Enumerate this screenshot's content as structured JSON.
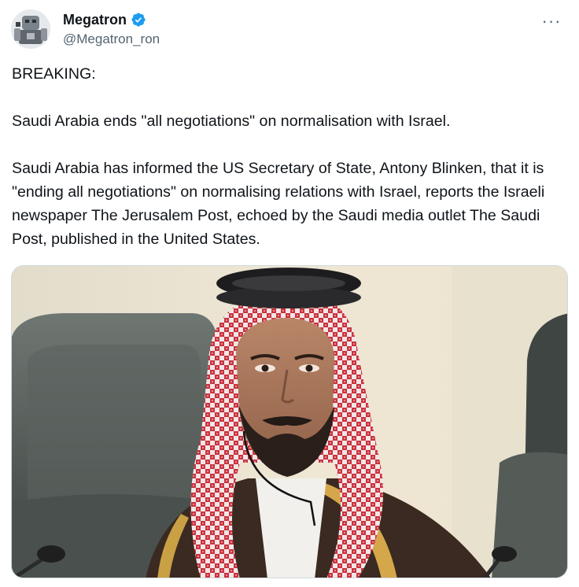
{
  "author": {
    "display_name": "Megatron",
    "handle": "@Megatron_ron",
    "avatar_icon": "robot-avatar-icon",
    "verified_icon": "verified-badge-icon",
    "verified_color": "#1d9bf0"
  },
  "menu": {
    "more_icon": "more-options-icon",
    "more_glyph": "···"
  },
  "tweet": {
    "line1": "BREAKING:",
    "line2": "Saudi Arabia ends \"all negotiations\" on normalisation with Israel.",
    "line3": "Saudi Arabia has informed the US Secretary of State, Antony Blinken, that it is \"ending all negotiations\" on normalising relations with Israel, reports the Israeli newspaper The Jerusalem Post, echoed by the Saudi media outlet The Saudi Post, published in the United States."
  },
  "media": {
    "kind": "photo",
    "subject": "man-in-red-checkered-keffiyeh"
  },
  "colors": {
    "text": "#0f1419",
    "secondary": "#536471",
    "border": "#cfd9de"
  }
}
